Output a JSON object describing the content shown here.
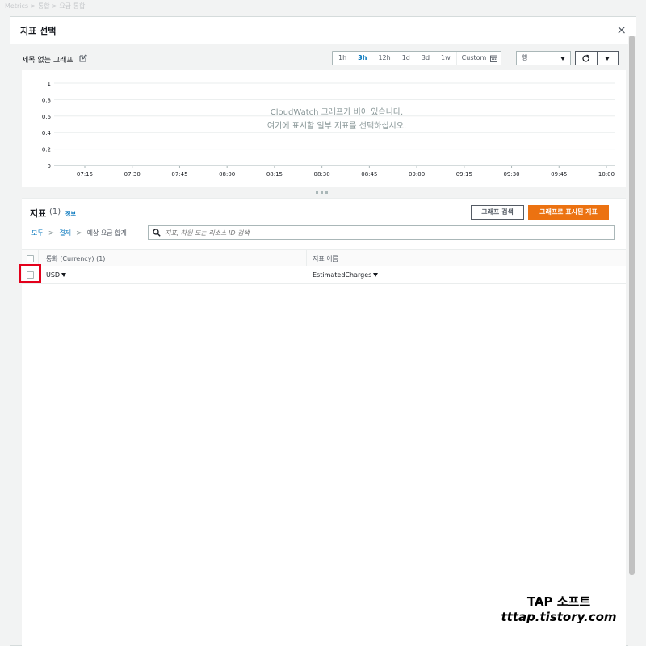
{
  "background": {
    "breadcrumb": "Metrics > 통합 > 요금 통합"
  },
  "modal": {
    "title": "지표 선택",
    "close_glyph": "×"
  },
  "graph": {
    "title": "제목 없는 그래프",
    "ranges": [
      "1h",
      "3h",
      "12h",
      "1d",
      "3d",
      "1w"
    ],
    "active_range": "3h",
    "custom_label": "Custom",
    "view_select": "행",
    "empty_line1": "CloudWatch 그래프가 비어 있습니다.",
    "empty_line2": "여기에 표시할 일부 지표를 선택하십시오."
  },
  "chart_data": {
    "type": "line",
    "x": [
      "07:15",
      "07:30",
      "07:45",
      "08:00",
      "08:15",
      "08:30",
      "08:45",
      "09:00",
      "09:15",
      "09:30",
      "09:45",
      "10:00"
    ],
    "y_ticks": [
      "1",
      "0.8",
      "0.6",
      "0.4",
      "0.2",
      "0"
    ],
    "series": [],
    "ylim": [
      0,
      1
    ],
    "grid": true
  },
  "metrics": {
    "title": "지표",
    "count": "(1)",
    "info_link": "정보",
    "search_graph_button": "그래프 검색",
    "graphed_metrics_button": "그래프로 표시된 지표",
    "breadcrumbs": {
      "all": "모두",
      "billing": "결제",
      "current": "예상 요금 합계"
    },
    "search_placeholder": "지표, 차원 또는 리소스 ID 검색",
    "columns": {
      "currency": "통화 (Currency) (1)",
      "metric_name": "지표 이름"
    },
    "rows": [
      {
        "currency": "USD",
        "metric_name": "EstimatedCharges"
      }
    ]
  },
  "watermark": {
    "line1": "TAP 소프트",
    "line2": "tttap.tistory.com"
  },
  "colors": {
    "accent": "#0073bb",
    "primary_button": "#ec7211",
    "highlight": "#e3001b"
  }
}
